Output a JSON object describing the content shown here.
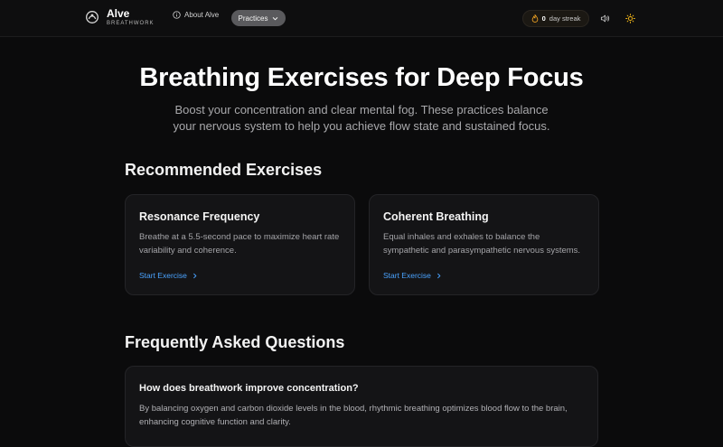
{
  "header": {
    "brand_name": "Alve",
    "brand_sub": "BREATHWORK",
    "about_label": "About Alve",
    "practices_label": "Practices",
    "streak_count": "0",
    "streak_label": "day streak"
  },
  "hero": {
    "title": "Breathing Exercises for Deep Focus",
    "subtitle": "Boost your concentration and clear mental fog. These practices balance your nervous system to help you achieve flow state and sustained focus."
  },
  "recommended": {
    "title": "Recommended Exercises",
    "cards": [
      {
        "title": "Resonance Frequency",
        "description": "Breathe at a 5.5-second pace to maximize heart rate variability and coherence.",
        "cta": "Start Exercise"
      },
      {
        "title": "Coherent Breathing",
        "description": "Equal inhales and exhales to balance the sympathetic and parasympathetic nervous systems.",
        "cta": "Start Exercise"
      }
    ]
  },
  "faq": {
    "title": "Frequently Asked Questions",
    "items": [
      {
        "question": "How does breathwork improve concentration?",
        "answer": "By balancing oxygen and carbon dioxide levels in the blood, rhythmic breathing optimizes blood flow to the brain, enhancing cognitive function and clarity."
      }
    ]
  },
  "colors": {
    "background": "#0b0b0c",
    "card": "#141416",
    "link": "#4aa3ff",
    "streak_flame": "#f5a623",
    "sun": "#f5b818"
  },
  "icons": {
    "logo": "breath-logo-icon",
    "about": "info-circle-icon",
    "practices": "chevron-down-icon",
    "streak": "flame-icon",
    "sound": "speaker-icon",
    "theme": "sun-icon",
    "cta": "chevron-right-icon"
  }
}
